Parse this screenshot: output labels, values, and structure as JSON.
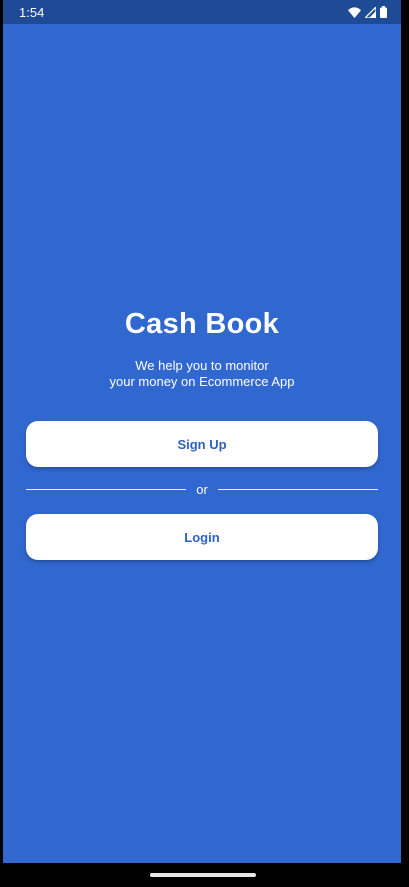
{
  "status_bar": {
    "time": "1:54",
    "icons": [
      "wifi-icon",
      "cell-signal-icon",
      "battery-icon"
    ]
  },
  "app": {
    "title": "Cash Book",
    "subtitle_line1": "We help you to monitor",
    "subtitle_line2": "your money on Ecommerce App",
    "signup_label": "Sign Up",
    "divider_label": "or",
    "login_label": "Login"
  },
  "colors": {
    "background": "#3168d0",
    "status_bar": "#1f4b96",
    "button_text": "#2f62c4",
    "button_bg": "#ffffff"
  }
}
